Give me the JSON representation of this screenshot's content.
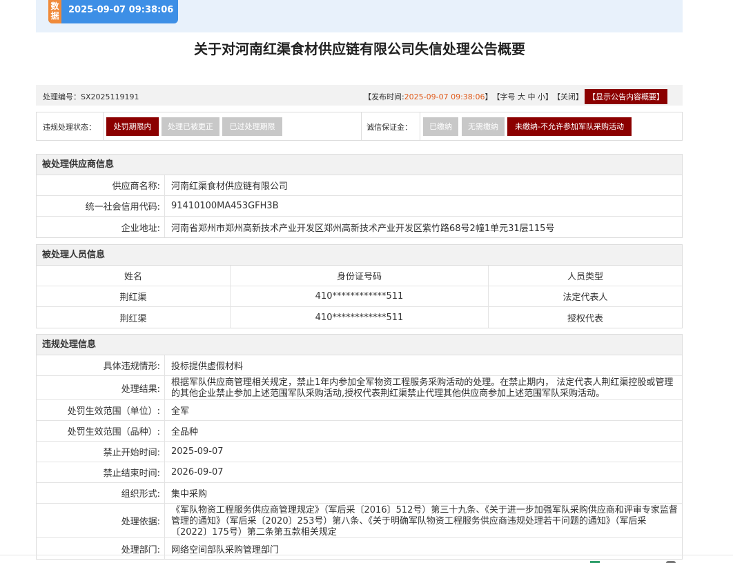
{
  "header": {
    "badge": "数据",
    "timestamp": "2025-09-07 09:38:06",
    "title": "关于对河南红渠食材供应链有限公司失信处理公告概要"
  },
  "infobar": {
    "number_text": "处理编号：SX2025119191",
    "pub_prefix": "【发布时间: ",
    "pub_time": "2025-09-07 09:38:06",
    "pub_suffix": "】",
    "font_size": "【字号 大 中 小】",
    "close": "【关闭】",
    "summary": "【显示公告内容概要】"
  },
  "status": {
    "violation_label": "违规处理状态：",
    "violation_options": [
      "处罚期限内",
      "处理已被更正",
      "已过处理期限"
    ],
    "violation_active": "处罚期限内",
    "deposit_label": "诚信保证金：",
    "deposit_options": [
      "已缴纳",
      "无需缴纳",
      "未缴纳-不允许参加军队采购活动"
    ],
    "deposit_active": "未缴纳-不允许参加军队采购活动",
    "active_color": "#8b0000",
    "inactive_color": "#c8c8c8"
  },
  "supplier": {
    "heading": "被处理供应商信息",
    "rows": [
      {
        "key": "供应商名称:",
        "value": "河南红渠食材供应链有限公司"
      },
      {
        "key": "统一社会信用代码:",
        "value": "91410100MA453GFH3B"
      },
      {
        "key": "企业地址:",
        "value": "河南省郑州市郑州高新技术产业开发区郑州高新技术产业开发区紫竹路68号2幢1单元31层115号"
      }
    ]
  },
  "persons": {
    "heading": "被处理人员信息",
    "columns": [
      "姓名",
      "身份证号码",
      "人员类型"
    ],
    "rows": [
      [
        "荆红渠",
        "410************511",
        "法定代表人"
      ],
      [
        "荆红渠",
        "410************511",
        "授权代表"
      ]
    ]
  },
  "violation": {
    "heading": "违规处理信息",
    "rows": [
      {
        "key": "具体违规情形:",
        "value": "投标提供虚假材料"
      },
      {
        "key": "处理结果:",
        "value": "根据军队供应商管理相关规定，禁止1年内参加全军物资工程服务采购活动的处理。在禁止期内， 法定代表人荆红渠控股或管理的其他企业禁止参加上述范围军队采购活动,授权代表荆红渠禁止代理其他供应商参加上述范围军队采购活动。"
      },
      {
        "key": "处罚生效范围（单位）:",
        "value": "全军"
      },
      {
        "key": "处罚生效范围（品种）:",
        "value": "全品种"
      },
      {
        "key": "禁止开始时间:",
        "value": "2025-09-07"
      },
      {
        "key": "禁止结束时间:",
        "value": "2026-09-07"
      },
      {
        "key": "组织形式:",
        "value": "集中采购"
      },
      {
        "key": "处理依据:",
        "value": "《军队物资工程服务供应商管理规定》（军后采〔2016〕512号）第三十九条、《关于进一步加强军队采购供应商和评审专家监督管理的通知》（军后采〔2020〕253号）第八条、《关于明确军队物资工程服务供应商违规处理若干问题的通知》（军后采〔2022〕175号）第二条第五款相关规定"
      },
      {
        "key": "处理部门:",
        "value": "网络空间部队采购管理部门"
      }
    ]
  }
}
